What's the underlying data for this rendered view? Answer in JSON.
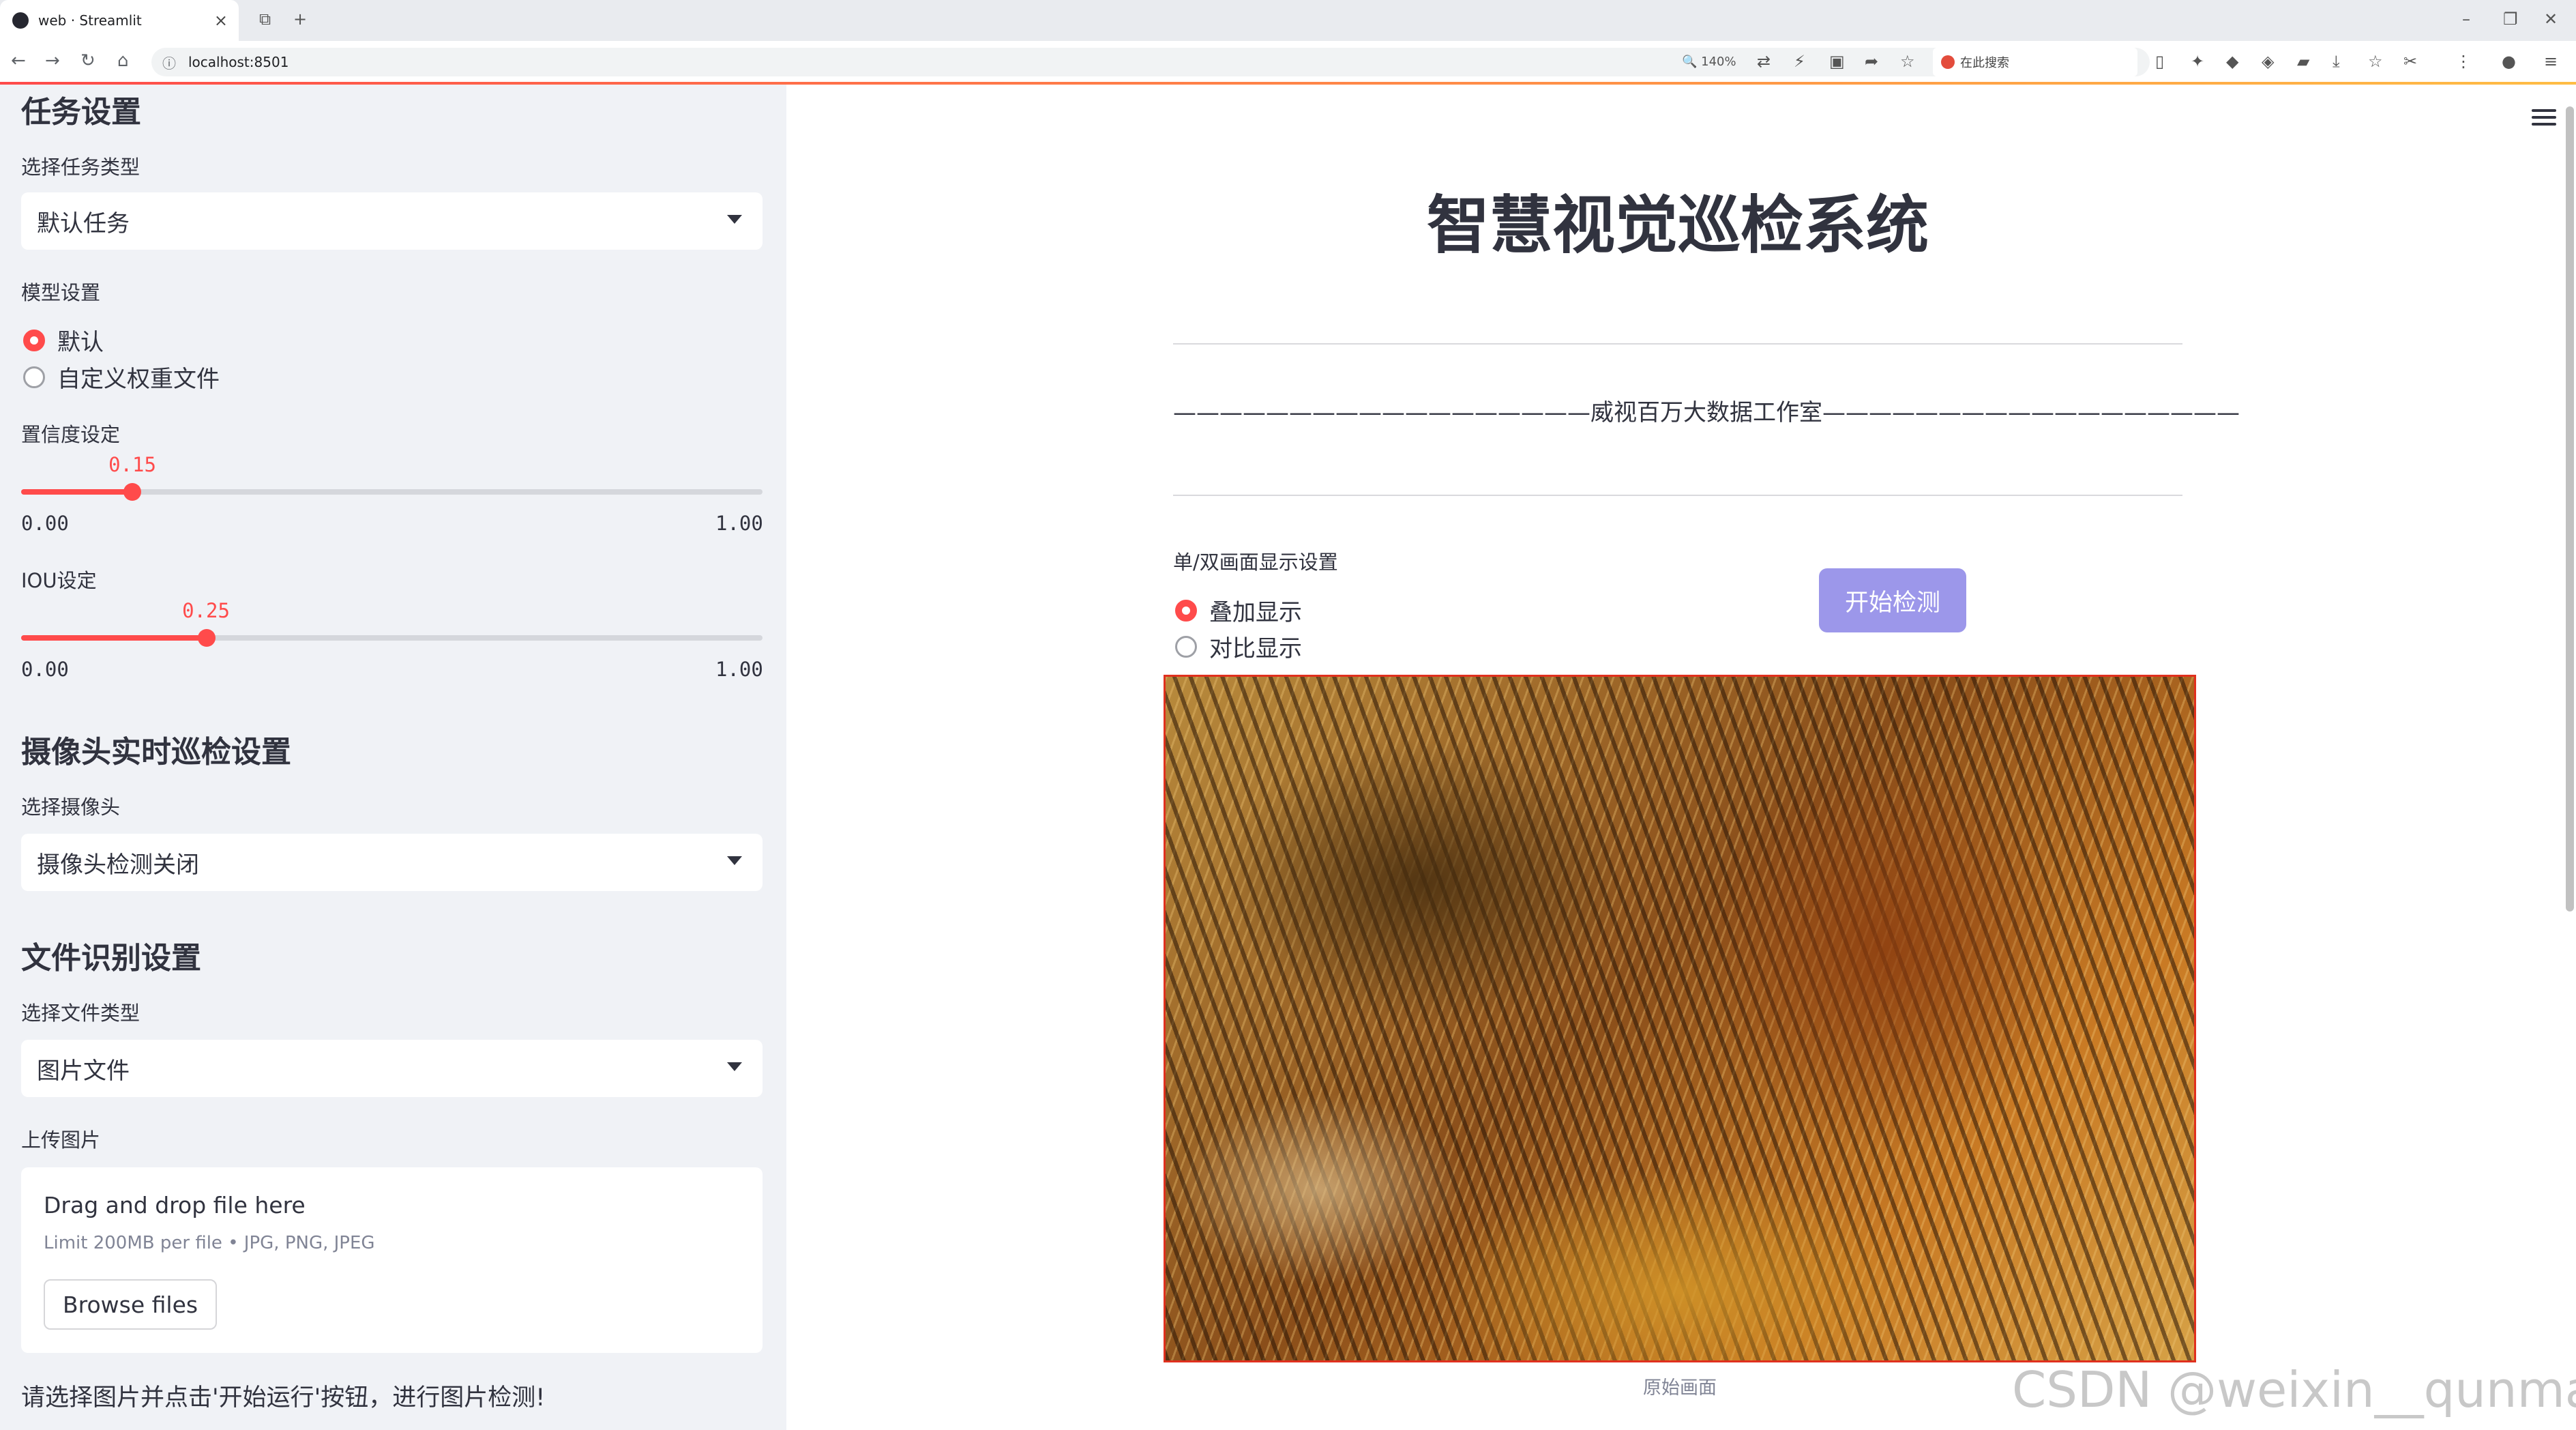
{
  "browser": {
    "tab_title": "web · Streamlit",
    "url": "localhost:8501",
    "zoom": "140%",
    "search_placeholder": "在此搜索"
  },
  "sidebar": {
    "task_header": "任务设置",
    "task_type_label": "选择任务类型",
    "task_type_value": "默认任务",
    "model_label": "模型设置",
    "model_options": [
      "默认",
      "自定义权重文件"
    ],
    "model_selected": 0,
    "conf_label": "置信度设定",
    "conf_value": "0.15",
    "conf_fraction": 0.15,
    "conf_min": "0.00",
    "conf_max": "1.00",
    "iou_label": "IOU设定",
    "iou_value": "0.25",
    "iou_fraction": 0.25,
    "iou_min": "0.00",
    "iou_max": "1.00",
    "camera_header": "摄像头实时巡检设置",
    "camera_label": "选择摄像头",
    "camera_value": "摄像头检测关闭",
    "file_header": "文件识别设置",
    "file_type_label": "选择文件类型",
    "file_type_value": "图片文件",
    "upload_label": "上传图片",
    "upload_drag": "Drag and drop file here",
    "upload_limit": "Limit 200MB per file • JPG, PNG, JPEG",
    "upload_button": "Browse files",
    "hint": "请选择图片并点击'开始运行'按钮，进行图片检测!"
  },
  "main": {
    "title": "智慧视觉巡检系统",
    "subtitle": "——————————————————威视百万大数据工作室——————————————————",
    "display_label": "单/双画面显示设置",
    "display_options": [
      "叠加显示",
      "对比显示"
    ],
    "display_selected": 0,
    "start_button": "开始检测",
    "image_caption": "原始画面"
  },
  "watermark": "CSDN @weixin__qunmasj"
}
